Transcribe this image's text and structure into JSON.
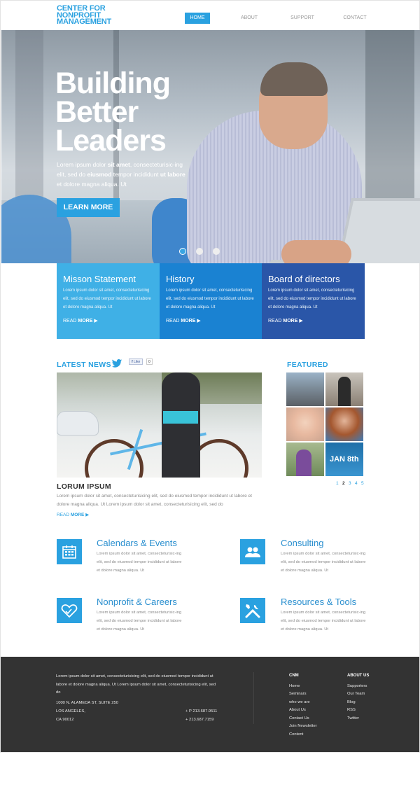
{
  "logo": {
    "line1": "CENTER FOR",
    "line2": "NONPROFIT",
    "line3": "MANAGEMENT"
  },
  "nav": {
    "items": [
      "HOME",
      "ABOUT",
      "SUPPORT",
      "CONTACT"
    ],
    "active": "HOME"
  },
  "hero": {
    "title_lines": [
      "Building",
      "Better",
      "Leaders"
    ],
    "text_1": "Lorem ipsum dolor ",
    "text_b1": "sit amet",
    "text_2": ", consecteturisic-ing elit, sed do ",
    "text_b2": "eiusmod",
    "text_3": " tempor incididunt ",
    "text_b3": "ut labore",
    "text_4": " et dolore magna aliqua. Ut",
    "button": "LEARN MORE",
    "slides": 3,
    "active_slide": 1
  },
  "boxes": [
    {
      "title": "Misson Statement",
      "text": "Lorem ipsum dolor sit amet, consecteturisicing elit, sed do eiusmod tempor incididunt ut labore et dolore magna aliqua. Ut",
      "more_a": "READ ",
      "more_b": "MORE",
      "color": "#3fb0e6"
    },
    {
      "title": "History",
      "text": "Lorem ipsum dolor sit amet, consecteturisicing elit, sed do eiusmod tempor incididunt ut labore et dolore magna aliqua. Ut",
      "more_a": "READ ",
      "more_b": "MORE",
      "color": "#1a82d2"
    },
    {
      "title": "Board of directors",
      "text": "Lorem ipsum dolor sit amet, consecteturisicing elit, sed do eiusmod tempor incididunt ut labore et dolore magna aliqua. Ut",
      "more_a": "READ ",
      "more_b": "MORE",
      "color": "#2a56a8"
    }
  ],
  "news": {
    "heading": "LATEST NEWS",
    "like_label": "Like",
    "like_count": "0",
    "title": "LORUM IPSUM",
    "text": "Lorem ipsum dolor sit amet, consecteturisicing elit, sed do eiusmod tempor incididunt ut labore et dolore magna aliqua. Ut Lorem ipsum dolor sit amet, consecteturisicing elit, sed do",
    "more_a": "READ ",
    "more_b": "MORE"
  },
  "featured": {
    "heading": "FEATURED",
    "date_label": "JAN 8th",
    "pages": [
      "1",
      "2",
      "3",
      "4",
      "5"
    ],
    "active_page": "2"
  },
  "services": [
    {
      "title": "Calendars & Events",
      "text": "Lorem ipsum dolor sit amet, consecteturisic-ing elit, sed do eiusmod tempor incididunt ut labore et dolore magna aliqua. Ut",
      "icon": "calendar-icon"
    },
    {
      "title": "Consulting",
      "text": "Lorem ipsum dolor sit amet, consecteturisic-ing elit, sed do eiusmod tempor incididunt ut labore et dolore magna aliqua. Ut",
      "icon": "people-icon"
    },
    {
      "title": "Nonprofit & Careers",
      "text": "Lorem ipsum dolor sit amet, consecteturisic-ing elit, sed do eiusmod tempor incididunt ut labore et dolore magna aliqua. Ut",
      "icon": "heart-hands-icon"
    },
    {
      "title": "Resources & Tools",
      "text": "Lorem ipsum dolor sit amet, consecteturisic-ing elit, sed do eiusmod tempor incididunt ut labore et dolore magna aliqua. Ut",
      "icon": "tools-icon"
    }
  ],
  "footer": {
    "blurb_1": "Lorem ipsum dolor sit amet, consecteturisicing elit, sed do eiusmod tempor incididunt ut",
    "blurb_2": "labore et dolore magna aliqua. Ut Lorem ipsum dolor sit amet, consecteturisicing elit, sed",
    "blurb_3": "do",
    "address_1": "1000 N. ALAMEDA ST, SUITE 250",
    "address_2": "LOS ANGELES,",
    "address_3": "CA 90012",
    "phone": "+ P 213.687.9511",
    "fax": "+ 213.687.7159",
    "col1_head": "CNM",
    "col1_links": [
      "Home",
      "Seminars",
      "who we are",
      "About Us",
      "Contact Us",
      "Join Newsletter",
      "Content"
    ],
    "col2_head": "ABOUT US",
    "col2_links": [
      "Supporters",
      "Our Team",
      "Blog",
      "RSS",
      "Twitter"
    ]
  }
}
